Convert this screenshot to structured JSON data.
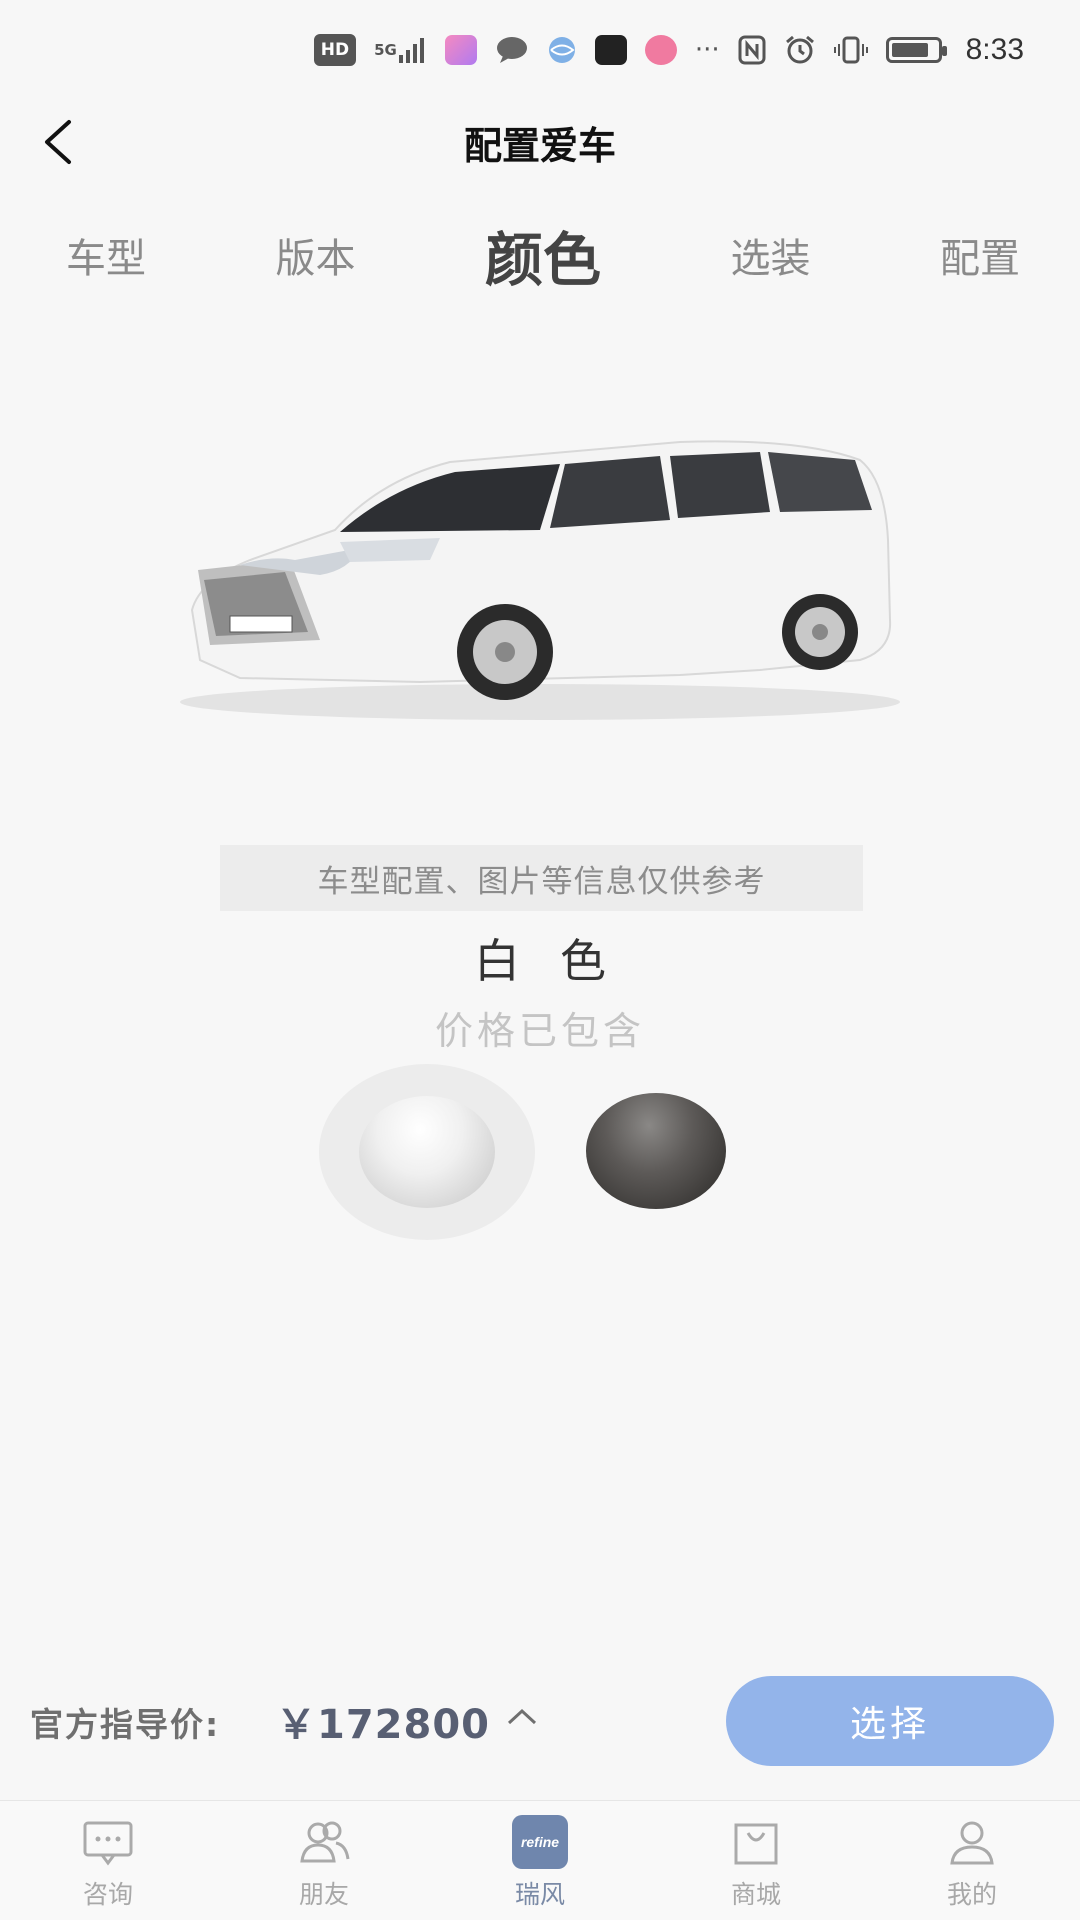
{
  "status_bar": {
    "hd": "HD",
    "network": "5G",
    "time": "8:33"
  },
  "header": {
    "title": "配置爱车"
  },
  "steps": [
    {
      "label": "车型"
    },
    {
      "label": "版本"
    },
    {
      "label": "颜色"
    },
    {
      "label": "选装"
    },
    {
      "label": "配置"
    }
  ],
  "active_step": "颜色",
  "disclaimer": "车型配置、图片等信息仅供参考",
  "color": {
    "name": "白色",
    "price_note": "价格已包含",
    "swatches": [
      {
        "name": "white",
        "hex": "#efefef",
        "selected": true
      },
      {
        "name": "gray",
        "hex": "#4a4846",
        "selected": false
      }
    ]
  },
  "price_bar": {
    "label": "官方指导价:",
    "value": "￥172800",
    "select_label": "选择"
  },
  "bottom_nav": [
    {
      "label": "咨询",
      "icon": "chat-icon"
    },
    {
      "label": "朋友",
      "icon": "friends-icon"
    },
    {
      "label": "瑞风",
      "icon": "refine-brand-icon",
      "brand_text": "refine"
    },
    {
      "label": "商城",
      "icon": "shopping-bag-icon"
    },
    {
      "label": "我的",
      "icon": "profile-icon"
    }
  ],
  "colors": {
    "accent": "#93b4ea",
    "price_text": "#585f73",
    "brand_nav": "#6f86ad"
  }
}
